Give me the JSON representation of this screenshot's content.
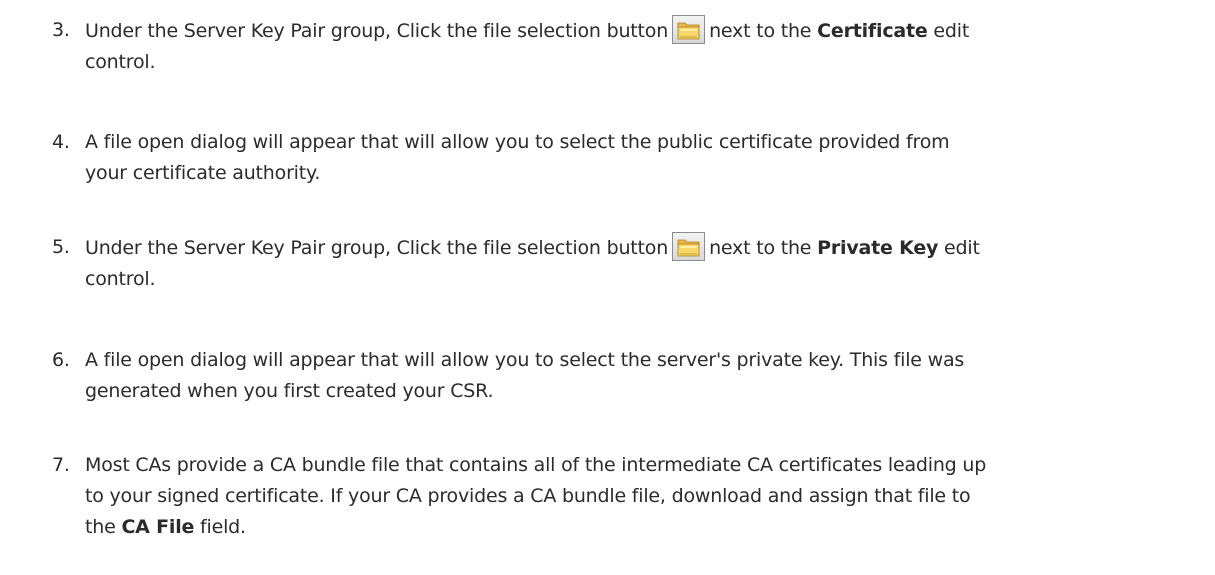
{
  "steps": [
    {
      "number": "3.",
      "before": "Under the Server Key Pair group, Click the file selection button",
      "after": "next to the",
      "bold": "Certificate",
      "tail": "edit",
      "line2": "control.",
      "icon": "folder-open-icon"
    },
    {
      "number": "4.",
      "line1": "A file open dialog will appear that will allow you to select the public certificate provided from",
      "line2": "your certificate authority."
    },
    {
      "number": "5.",
      "before": "Under the Server Key Pair group, Click the file selection button",
      "after": "next to the",
      "bold": "Private Key",
      "tail": "edit",
      "line2": "control.",
      "icon": "folder-open-icon"
    },
    {
      "number": "6.",
      "line1": "A file open dialog will appear that will allow you to select the server's private key. This file was",
      "line2": "generated when you first created your CSR."
    },
    {
      "number": "7.",
      "line1": "Most CAs provide a CA bundle file that contains all of the intermediate CA certificates leading up",
      "line2": "to your signed certificate. If your CA provides a CA bundle file, download and assign that file to",
      "line3_pre": "the",
      "line3_bold": "CA File",
      "line3_post": "field."
    }
  ]
}
